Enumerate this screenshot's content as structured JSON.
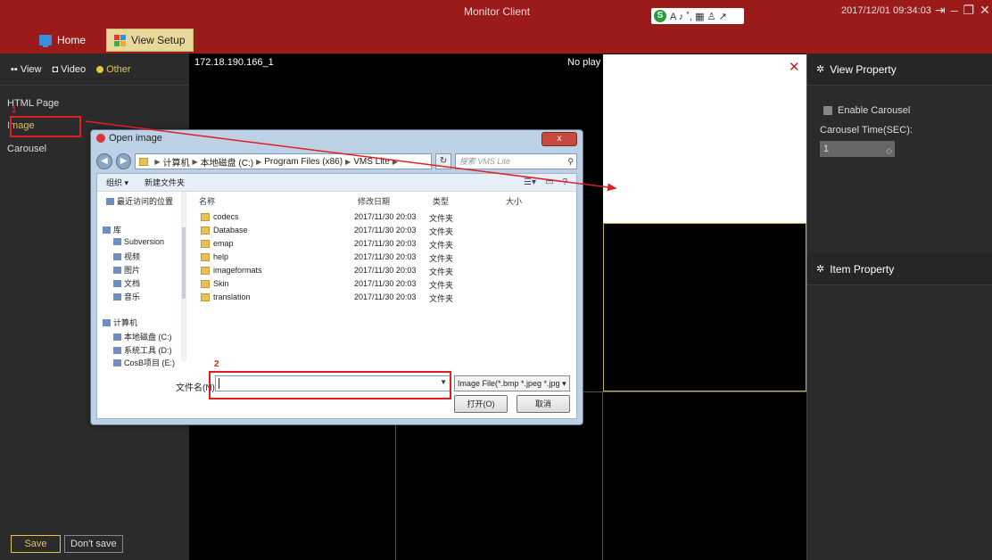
{
  "window": {
    "title": "Monitor Client",
    "datetime": "2017/12/01 09:34:03",
    "ime_text": "A ♪ ˚, ▦ ♙ ↗"
  },
  "top_tabs": [
    {
      "label": "Home"
    },
    {
      "label": "View Setup"
    }
  ],
  "left_panel": {
    "tabs": [
      {
        "label": "View"
      },
      {
        "label": "Video"
      },
      {
        "label": "Other"
      }
    ],
    "items": [
      {
        "label": "HTML Page"
      },
      {
        "label": "Image"
      },
      {
        "label": "Carousel"
      }
    ],
    "save_label": "Save",
    "dont_save_label": "Don't save"
  },
  "video_grid": {
    "cell1_label": "172.18.190.166_1",
    "cell2_label": "No play"
  },
  "right_panel": {
    "view_property": "View Property",
    "enable_carousel": "Enable Carousel",
    "carousel_time_label": "Carousel Time(SEC):",
    "carousel_time_value": "1",
    "item_property": "Item Property"
  },
  "dialog": {
    "title": "Open image",
    "close_label": "x",
    "path": [
      "计算机",
      "本地磁盘 (C:)",
      "Program Files (x86)",
      "VMS Lite"
    ],
    "search_placeholder": "搜索 VMS Lite",
    "toolbar": {
      "organize": "组织 ▾",
      "new_folder": "新建文件夹"
    },
    "nav": [
      {
        "label": "最近访问的位置"
      },
      {
        "label": "库"
      },
      {
        "label": "Subversion"
      },
      {
        "label": "视频"
      },
      {
        "label": "图片"
      },
      {
        "label": "文档"
      },
      {
        "label": "音乐"
      },
      {
        "label": "计算机"
      },
      {
        "label": "本地磁盘 (C:)"
      },
      {
        "label": "系统工具 (D:)"
      },
      {
        "label": "CosB项目 (E:)"
      }
    ],
    "columns": {
      "name": "名称",
      "modified": "修改日期",
      "type": "类型",
      "size": "大小"
    },
    "files": [
      {
        "name": "codecs",
        "date": "2017/11/30 20:03",
        "type": "文件夹"
      },
      {
        "name": "Database",
        "date": "2017/11/30 20:03",
        "type": "文件夹"
      },
      {
        "name": "emap",
        "date": "2017/11/30 20:03",
        "type": "文件夹"
      },
      {
        "name": "help",
        "date": "2017/11/30 20:03",
        "type": "文件夹"
      },
      {
        "name": "imageformats",
        "date": "2017/11/30 20:03",
        "type": "文件夹"
      },
      {
        "name": "Skin",
        "date": "2017/11/30 20:03",
        "type": "文件夹"
      },
      {
        "name": "translation",
        "date": "2017/11/30 20:03",
        "type": "文件夹"
      }
    ],
    "filename_label": "文件名(N):",
    "filename_value": "",
    "filter": "Image File(*.bmp *.jpeg *.jpg",
    "open_label": "打开(O)",
    "cancel_label": "取消"
  },
  "annotations": {
    "step1": "1",
    "step2": "2"
  },
  "colors": {
    "titlebar": "#9b1b1b",
    "accent": "#e6c445",
    "annotation": "#e02020"
  }
}
